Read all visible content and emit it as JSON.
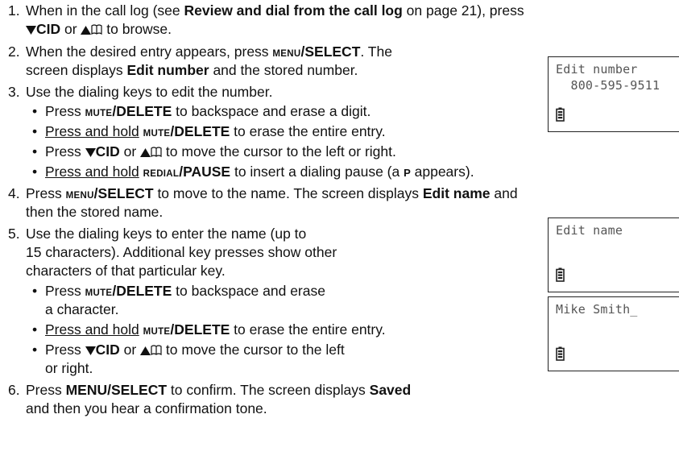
{
  "steps": {
    "s1": {
      "num": "1.",
      "a": "When in the call log (see ",
      "ref": "Review and dial from the call log",
      "b": " on page 21), press",
      "cid": "CID",
      "or": " or ",
      "c": " to browse."
    },
    "s2": {
      "num": "2.",
      "a": "When the desired entry appears, press ",
      "menu": "MENU",
      "select": "/SELECT",
      "b": ". The",
      "c": "screen displays ",
      "edit_number": "Edit number",
      "d": " and the stored number."
    },
    "s3": {
      "num": "3.",
      "text": "Use the dialing keys to edit the number.",
      "bullets": {
        "b1": {
          "press": "Press ",
          "mute": "MUTE",
          "delete": "/DELETE",
          "rest": " to backspace and erase a digit."
        },
        "b2": {
          "hold": "Press and hold",
          "sp": " ",
          "mute": "MUTE",
          "delete": "/DELETE",
          "rest": " to erase the entire entry."
        },
        "b3": {
          "press": "Press ",
          "cid": "CID",
          "or": " or ",
          "rest": " to move the cursor to the left or right."
        },
        "b4": {
          "hold": "Press and hold",
          "sp": " ",
          "redial": "REDIAL",
          "pause": "/PAUSE",
          "rest1": " to insert a dialing pause (a ",
          "p": "P",
          "rest2": " appears)."
        }
      }
    },
    "s4": {
      "num": "4.",
      "a": "Press ",
      "menu": "MENU",
      "select": "/SELECT",
      "b": " to move to the name. The screen displays ",
      "edit_name": "Edit name",
      "c": " and",
      "d": "then the stored name."
    },
    "s5": {
      "num": "5.",
      "a": "Use the dialing keys to enter the name (up to",
      "b": "15 characters). Additional key presses show other",
      "c": "characters of that particular key.",
      "bullets": {
        "b1": {
          "press": "Press ",
          "mute": "MUTE",
          "delete": "/DELETE",
          "rest": " to backspace and erase",
          "cont": "a character."
        },
        "b2": {
          "hold": "Press and hold",
          "sp": " ",
          "mute": "MUTE",
          "delete": "/DELETE",
          "rest": " to erase the entire entry."
        },
        "b3": {
          "press": "Press ",
          "cid": "CID",
          "or": " or ",
          "rest": " to move the cursor to the left",
          "cont": "or right."
        }
      }
    },
    "s6": {
      "num": "6.",
      "a": "Press ",
      "menuselect": "MENU/SELECT",
      "b": " to confirm. The screen displays ",
      "saved": "Saved",
      "c": "and then you hear a confirmation tone."
    }
  },
  "screens": {
    "edit_number": {
      "line1": "Edit number",
      "line2": "  800-595-9511"
    },
    "edit_name": {
      "line1": "Edit name"
    },
    "name_entry": {
      "line1": "Mike Smith_"
    }
  },
  "icons": {
    "down_arrow": "down-triangle-icon",
    "up_arrow": "up-triangle-icon",
    "phonebook": "phonebook-icon",
    "battery": "battery-icon"
  }
}
